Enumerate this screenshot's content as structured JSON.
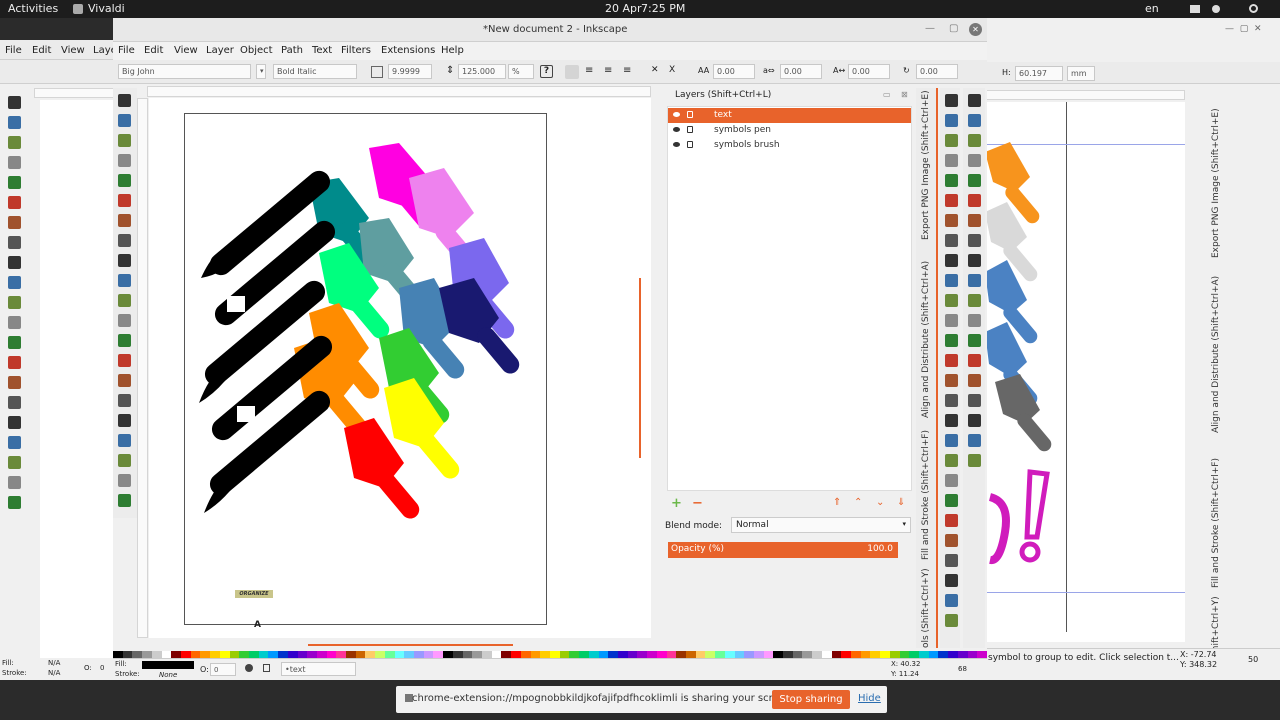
{
  "topbar": {
    "activities": "Activities",
    "app": "Vivaldi",
    "date": "20 Apr",
    "time": "7:25 PM",
    "lang": "en"
  },
  "window": {
    "title": "*New document 2 - Inkscape"
  },
  "menu": {
    "items": [
      "File",
      "Edit",
      "View",
      "Layer",
      "Object",
      "Path",
      "Text",
      "Filters",
      "Extensions",
      "Help"
    ],
    "left_items": [
      "File",
      "Edit",
      "View",
      "Laye"
    ]
  },
  "textbar": {
    "font": "Big John",
    "style": "Bold Italic",
    "size": "9.9999",
    "line_spacing": "125.000",
    "unit": "%",
    "x0": "0.00",
    "x1": "0.00",
    "x2": "0.00",
    "x3": "0.00",
    "h_label": "H:",
    "h": "60.197",
    "unit2": "mm"
  },
  "layers": {
    "title": "Layers (Shift+Ctrl+L)",
    "items": [
      "text",
      "symbols pen",
      "symbols brush"
    ],
    "blend_label": "Blend mode:",
    "blend": "Normal",
    "opacity_label": "Opacity (%)",
    "opacity": "100.0"
  },
  "docktabs": [
    "Export PNG Image (Shift+Ctrl+E)",
    "Align and Distribute (Shift+Ctrl+A)",
    "Fill and Stroke (Shift+Ctrl+F)",
    "ols (Shift+Ctrl+Y)"
  ],
  "docktabs_right": [
    "Export PNG Image (Shift+Ctrl+E)",
    "Align and Distribute (Shift+Ctrl+A)",
    "Fill and Stroke (Shift+Ctrl+F)",
    "s (Shift+Ctrl+Y)"
  ],
  "canvas": {
    "small_text": "ORGANIZE",
    "exclaim": "!"
  },
  "status": {
    "fill_label": "Fill:",
    "fill_val": "N/A",
    "stroke_label": "Stroke:",
    "stroke_val": "N/A",
    "o_label": "O:",
    "o_val": "0",
    "stroke_none": "None",
    "opacity_val": "0",
    "layer": "•text",
    "cx": "X: 40.32",
    "cy": "Y: 11.24",
    "zoom": "68",
    "msg": "symbol to group to edit. Click selection t...",
    "cx2": "X: -72.74",
    "cy2": "Y: 348.32",
    "zoom2": "50"
  },
  "sharebar": {
    "msg": "chrome-extension://mpognobbkildjkofajifpdfhcoklimli is sharing your screen.",
    "stop": "Stop sharing",
    "hide": "Hide"
  },
  "colors": {
    "accent": "#e8632b",
    "palette": [
      "#000000",
      "#333333",
      "#666666",
      "#999999",
      "#cccccc",
      "#ffffff",
      "#800000",
      "#ff0000",
      "#ff6600",
      "#ff9900",
      "#ffcc00",
      "#ffff00",
      "#99cc00",
      "#33cc33",
      "#00cc66",
      "#00cccc",
      "#0099ff",
      "#0033cc",
      "#3300cc",
      "#6600cc",
      "#9900cc",
      "#cc00cc",
      "#ff00cc",
      "#ff3399",
      "#993300",
      "#cc6600",
      "#ffcc66",
      "#ccff66",
      "#66ff99",
      "#66ffff",
      "#66ccff",
      "#9999ff",
      "#cc99ff",
      "#ff99ff"
    ]
  }
}
